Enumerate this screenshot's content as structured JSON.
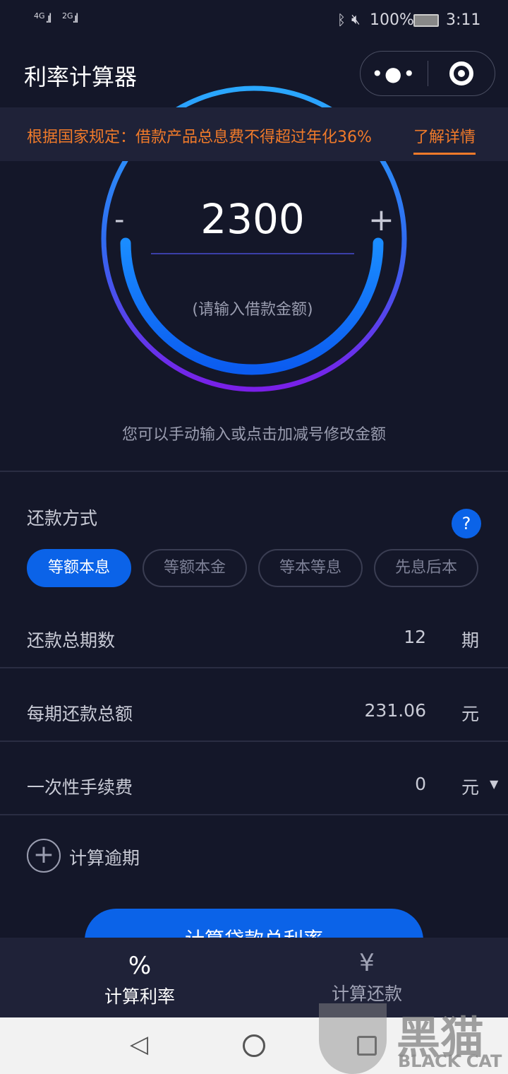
{
  "status_bar": {
    "signal1": "4G",
    "signal2": "2G",
    "battery": "100%",
    "time": "3:11"
  },
  "header": {
    "title": "利率计算器"
  },
  "banner": {
    "text": "根据国家规定：借款产品总息费不得超过年化36%",
    "link": "了解详情"
  },
  "amount": {
    "value": "2300",
    "minus": "-",
    "plus": "+",
    "placeholder": "(请输入借款金额)",
    "hint": "您可以手动输入或点击加减号修改金额"
  },
  "repayment": {
    "label": "还款方式",
    "help": "?",
    "options": [
      {
        "label": "等额本息",
        "selected": true
      },
      {
        "label": "等额本金"
      },
      {
        "label": "等本等息"
      },
      {
        "label": "先息后本"
      }
    ]
  },
  "fields": [
    {
      "label": "还款总期数",
      "value": "12",
      "unit": "期"
    },
    {
      "label": "每期还款总额",
      "value": "231.06",
      "unit": "元"
    },
    {
      "label": "一次性手续费",
      "value": "0",
      "unit": "元"
    }
  ],
  "overdue": {
    "label": "计算逾期"
  },
  "submit": {
    "label": "计算贷款总利率"
  },
  "tabs": [
    {
      "icon": "%",
      "label": "计算利率",
      "active": true
    },
    {
      "icon": "¥",
      "label": "计算还款"
    }
  ],
  "watermark": {
    "text": "黑猫",
    "sub": "BLACK CAT"
  },
  "colors": {
    "accent": "#0b63e8",
    "warning": "#f07a2a",
    "background": "#141729"
  }
}
